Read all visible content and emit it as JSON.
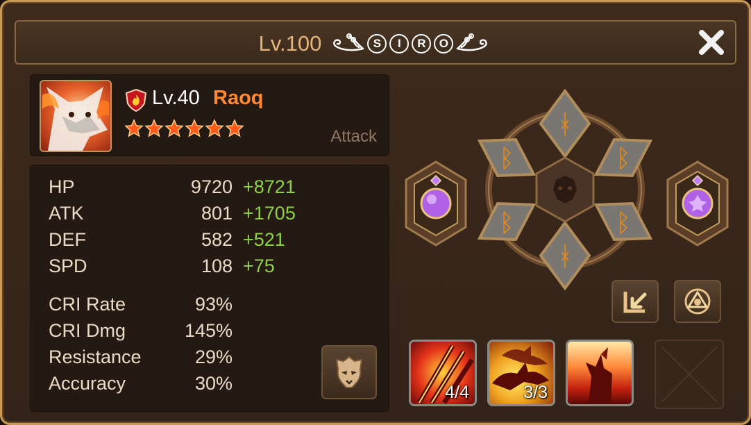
{
  "header": {
    "level": "Lv.100",
    "player_name_letters": [
      "S",
      "I",
      "R",
      "O"
    ]
  },
  "monster": {
    "level": "Lv.40",
    "name": "Raoq",
    "stars": 6,
    "type": "Attack",
    "element": "fire"
  },
  "stats": [
    {
      "label": "HP",
      "base": "9720",
      "bonus": "+8721"
    },
    {
      "label": "ATK",
      "base": "801",
      "bonus": "+1705"
    },
    {
      "label": "DEF",
      "base": "582",
      "bonus": "+521"
    },
    {
      "label": "SPD",
      "base": "108",
      "bonus": "+75"
    },
    {
      "label": "CRI Rate",
      "base": "93%",
      "bonus": ""
    },
    {
      "label": "CRI Dmg",
      "base": "145%",
      "bonus": ""
    },
    {
      "label": "Resistance",
      "base": "29%",
      "bonus": ""
    },
    {
      "label": "Accuracy",
      "base": "30%",
      "bonus": ""
    }
  ],
  "skills": [
    {
      "level": "4/4"
    },
    {
      "level": "3/3"
    },
    {
      "level": ""
    }
  ],
  "colors": {
    "header_level": "#e6b47a",
    "monster_name": "#ff8a33",
    "stat_bonus": "#8ed24a",
    "monster_type": "#8e7a63"
  }
}
